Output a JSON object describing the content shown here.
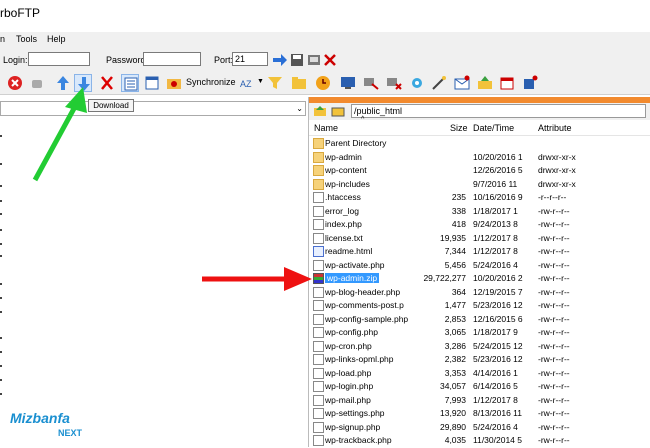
{
  "title": "rboFTP",
  "menu": {
    "items": [
      "n",
      "Tools",
      "Help"
    ]
  },
  "connection": {
    "login_label": "Login:",
    "password_label": "Password:",
    "port_label": "Port:",
    "port_value": "21"
  },
  "toolbar": {
    "synchronize_label": "Synchronize",
    "download_tooltip": "Download"
  },
  "remote": {
    "path": "/public_html",
    "headers": {
      "name": "Name",
      "size": "Size",
      "date": "Date/Time",
      "attr": "Attribute"
    },
    "rows": [
      {
        "name": "Parent Directory",
        "size": "",
        "date": "",
        "attr": "",
        "icon": "parent-folder-icon"
      },
      {
        "name": "wp-admin",
        "size": "",
        "date": "10/20/2016 1",
        "attr": "drwxr-xr-x",
        "icon": "folder-icon"
      },
      {
        "name": "wp-content",
        "size": "",
        "date": "12/26/2016 5",
        "attr": "drwxr-xr-x",
        "icon": "folder-icon"
      },
      {
        "name": "wp-includes",
        "size": "",
        "date": "9/7/2016 11",
        "attr": "drwxr-xr-x",
        "icon": "folder-icon"
      },
      {
        "name": ".htaccess",
        "size": "235",
        "date": "10/16/2016 9",
        "attr": "-r--r--r--",
        "icon": "file-icon"
      },
      {
        "name": "error_log",
        "size": "338",
        "date": "1/18/2017 1",
        "attr": "-rw-r--r--",
        "icon": "file-icon"
      },
      {
        "name": "index.php",
        "size": "418",
        "date": "9/24/2013 8",
        "attr": "-rw-r--r--",
        "icon": "file-icon"
      },
      {
        "name": "license.txt",
        "size": "19,935",
        "date": "1/12/2017 8",
        "attr": "-rw-r--r--",
        "icon": "file-icon"
      },
      {
        "name": "readme.html",
        "size": "7,344",
        "date": "1/12/2017 8",
        "attr": "-rw-r--r--",
        "icon": "html-file-icon"
      },
      {
        "name": "wp-activate.php",
        "size": "5,456",
        "date": "5/24/2016 4",
        "attr": "-rw-r--r--",
        "icon": "file-icon"
      },
      {
        "name": "wp-admin.zip",
        "size": "29,722,277",
        "date": "10/20/2016 2",
        "attr": "-rw-r--r--",
        "icon": "zip-icon",
        "selected": true
      },
      {
        "name": "wp-blog-header.php",
        "size": "364",
        "date": "12/19/2015 7",
        "attr": "-rw-r--r--",
        "icon": "file-icon"
      },
      {
        "name": "wp-comments-post.p",
        "size": "1,477",
        "date": "5/23/2016 12",
        "attr": "-rw-r--r--",
        "icon": "file-icon"
      },
      {
        "name": "wp-config-sample.php",
        "size": "2,853",
        "date": "12/16/2015 6",
        "attr": "-rw-r--r--",
        "icon": "file-icon"
      },
      {
        "name": "wp-config.php",
        "size": "3,065",
        "date": "1/18/2017 9",
        "attr": "-rw-r--r--",
        "icon": "file-icon"
      },
      {
        "name": "wp-cron.php",
        "size": "3,286",
        "date": "5/24/2015 12",
        "attr": "-rw-r--r--",
        "icon": "file-icon"
      },
      {
        "name": "wp-links-opml.php",
        "size": "2,382",
        "date": "5/23/2016 12",
        "attr": "-rw-r--r--",
        "icon": "file-icon"
      },
      {
        "name": "wp-load.php",
        "size": "3,353",
        "date": "4/14/2016 1",
        "attr": "-rw-r--r--",
        "icon": "file-icon"
      },
      {
        "name": "wp-login.php",
        "size": "34,057",
        "date": "6/14/2016 5",
        "attr": "-rw-r--r--",
        "icon": "file-icon"
      },
      {
        "name": "wp-mail.php",
        "size": "7,993",
        "date": "1/12/2017 8",
        "attr": "-rw-r--r--",
        "icon": "file-icon"
      },
      {
        "name": "wp-settings.php",
        "size": "13,920",
        "date": "8/13/2016 11",
        "attr": "-rw-r--r--",
        "icon": "file-icon"
      },
      {
        "name": "wp-signup.php",
        "size": "29,890",
        "date": "5/24/2016 4",
        "attr": "-rw-r--r--",
        "icon": "file-icon"
      },
      {
        "name": "wp-trackback.php",
        "size": "4,035",
        "date": "11/30/2014 5",
        "attr": "-rw-r--r--",
        "icon": "file-icon"
      }
    ]
  },
  "branding": {
    "logo": "Mizbanfa",
    "logo_sub": "NEXT"
  },
  "colors": {
    "accent_orange": "#f28a2e",
    "selection": "#3399ff",
    "annotation_green": "#22cc33",
    "annotation_red": "#ee1111"
  }
}
